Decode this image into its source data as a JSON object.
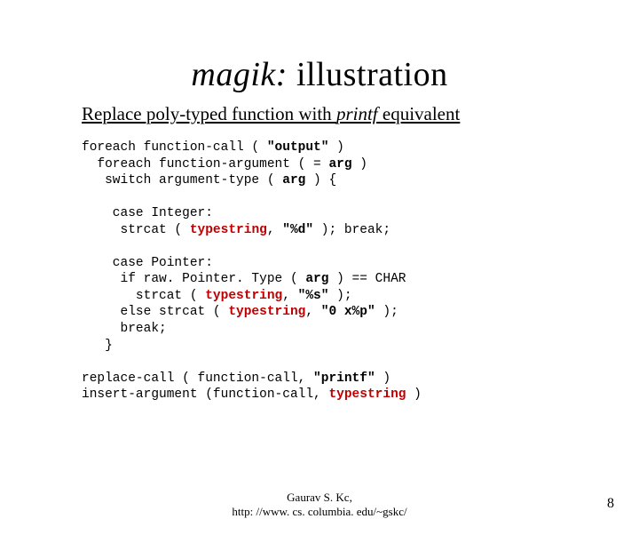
{
  "title": {
    "italic": "magik:",
    "rest": " illustration"
  },
  "subtitle": {
    "pre": "Replace poly-typed function with ",
    "italic": "printf",
    "post": " equivalent"
  },
  "code": {
    "l1a": "foreach function-call ( ",
    "l1b": "\"output\"",
    "l1c": " )",
    "l2a": "  foreach function-argument ( = ",
    "l2b": "arg",
    "l2c": " )",
    "l3a": "   switch argument-type ( ",
    "l3b": "arg",
    "l3c": " ) {",
    "l4": "",
    "l5": "    case Integer:",
    "l6a": "     strcat ( ",
    "l6b": "typestring",
    "l6c": ", ",
    "l6d": "\"%d\"",
    "l6e": " ); break;",
    "l7": "",
    "l8": "    case Pointer:",
    "l9a": "     if raw. Pointer. Type ( ",
    "l9b": "arg",
    "l9c": " ) == CHAR",
    "l10a": "       strcat ( ",
    "l10b": "typestring",
    "l10c": ", ",
    "l10d": "\"%s\"",
    "l10e": " );",
    "l11a": "     else strcat ( ",
    "l11b": "typestring",
    "l11c": ", ",
    "l11d": "\"0 x%p\"",
    "l11e": " );",
    "l12": "     break;",
    "l13": "   }",
    "l14": "",
    "l15a": "replace-call ( function-call, ",
    "l15b": "\"printf\"",
    "l15c": " )",
    "l16a": "insert-argument (function-call, ",
    "l16b": "typestring",
    "l16c": " )"
  },
  "footer": {
    "line1": "Gaurav S. Kc,",
    "line2": "http: //www. cs. columbia. edu/~gskc/"
  },
  "page": "8"
}
